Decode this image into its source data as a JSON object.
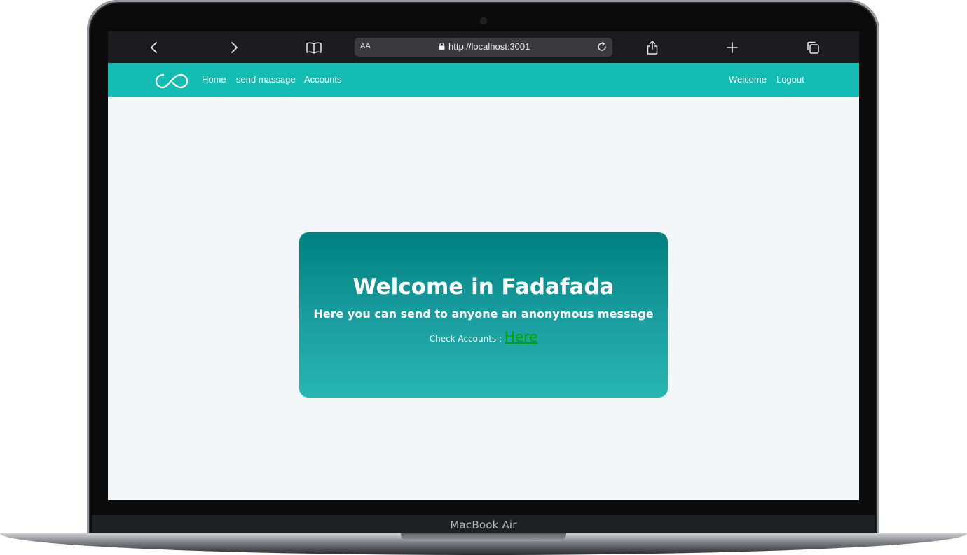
{
  "device": {
    "model_label": "MacBook Air"
  },
  "browser": {
    "back_icon": "chevron-left-icon",
    "forward_icon": "chevron-right-icon",
    "bookmarks_icon": "book-icon",
    "text_size_label": "AA",
    "url": "http://localhost:3001",
    "lock_icon": "lock-icon",
    "reload_icon": "reload-icon",
    "share_icon": "share-icon",
    "new_tab_icon": "plus-icon",
    "tabs_icon": "tabs-icon"
  },
  "navbar": {
    "color": "#14bdb3",
    "logo_icon": "infinity-logo-icon",
    "links": [
      "Home",
      "send massage",
      "Accounts"
    ],
    "right_links": [
      "Welcome",
      "Logout"
    ]
  },
  "hero": {
    "title": "Welcome in Fadafada",
    "subtitle": "Here you can send to anyone an anonymous message",
    "check_label": "Check Accounts :",
    "link_label": "Here",
    "link_color": "#00a400",
    "gradient_top": "#008080",
    "gradient_bottom": "#27b6b2"
  }
}
